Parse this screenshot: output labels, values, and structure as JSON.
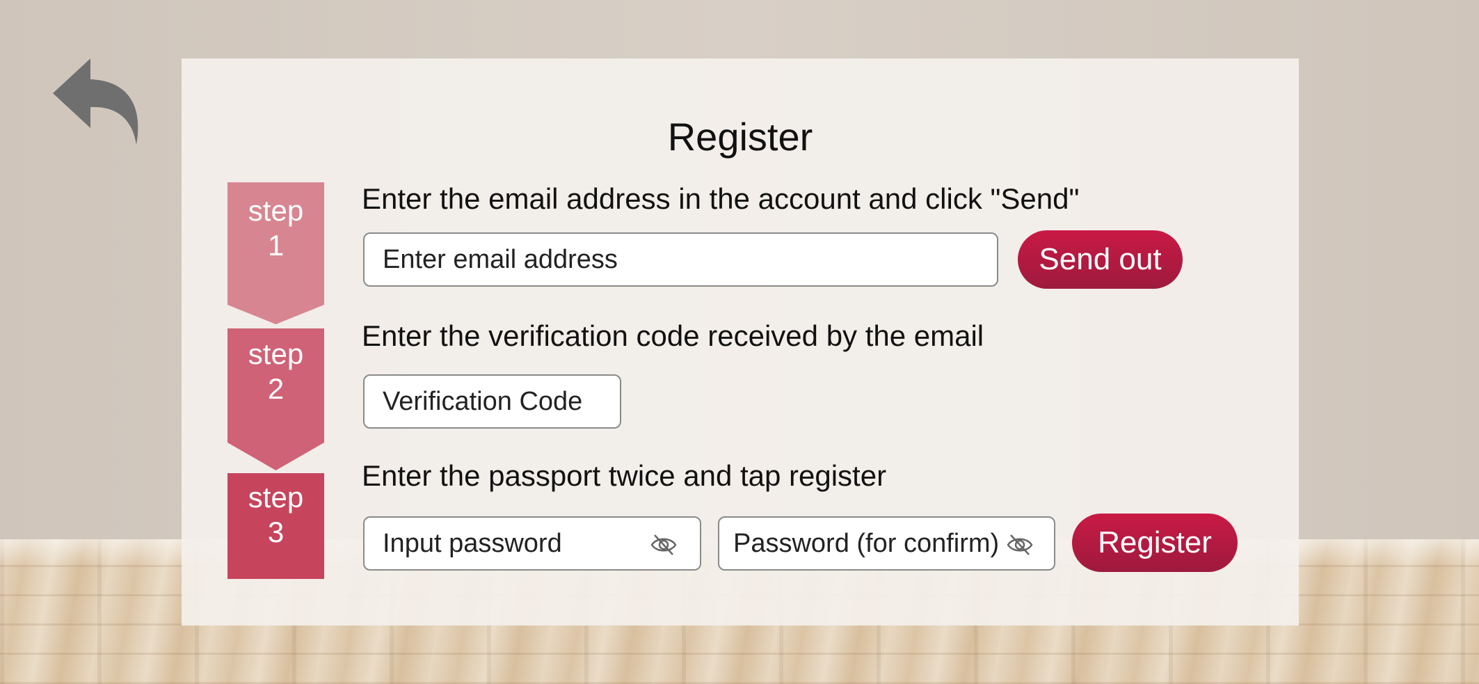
{
  "title": "Register",
  "steps": [
    {
      "badge_word": "step",
      "badge_number": "1",
      "instruction": "Enter the email address in the account and click \"Send\"",
      "email_placeholder": "Enter email address",
      "button_label": "Send out"
    },
    {
      "badge_word": "step",
      "badge_number": "2",
      "instruction": "Enter the verification code received by the email",
      "code_placeholder": "Verification Code"
    },
    {
      "badge_word": "step",
      "badge_number": "3",
      "instruction": "Enter the passport twice and tap register",
      "password_placeholder": "Input password",
      "confirm_placeholder": "Password (for confirm)",
      "button_label": "Register"
    }
  ],
  "icons": {
    "back": "back-arrow-icon",
    "password_visibility": "eye-off-icon"
  },
  "colors": {
    "step1": "#d78591",
    "step2": "#cf6277",
    "step3": "#c6445c",
    "accent_button": "#b81a42"
  }
}
